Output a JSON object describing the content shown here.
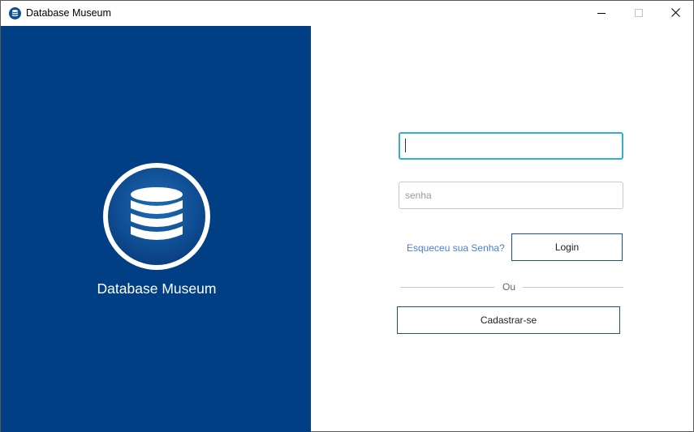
{
  "window": {
    "title": "Database Museum",
    "icon": "database-icon",
    "controls": [
      "minimize-icon",
      "maximize-icon",
      "close-icon"
    ]
  },
  "brand": {
    "name": "Database Museum",
    "logo_icon": "database-icon",
    "background_color": "#003f83"
  },
  "login": {
    "username_value": "",
    "username_placeholder": "",
    "password_value": "",
    "password_placeholder": "senha",
    "forgot_label": "Esqueceu sua Senha?",
    "login_label": "Login",
    "divider_label": "Ou",
    "register_label": "Cadastrar-se",
    "focus_color": "#36b0c6",
    "link_color": "#4a7fd4"
  }
}
